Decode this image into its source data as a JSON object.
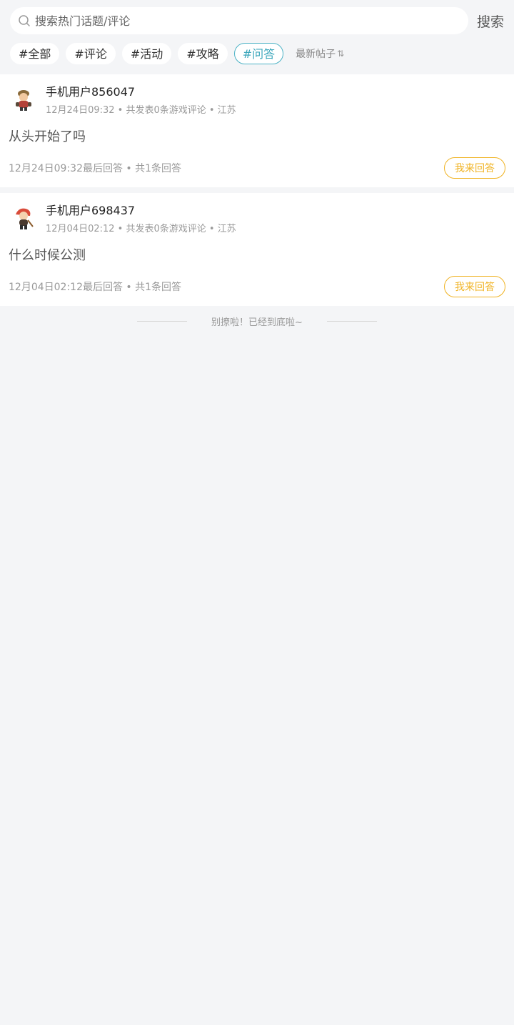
{
  "search": {
    "placeholder": "搜索热门话题/评论",
    "button_label": "搜索",
    "icon": "search-icon"
  },
  "tags": [
    {
      "label": "#全部",
      "active": false
    },
    {
      "label": "#评论",
      "active": false
    },
    {
      "label": "#活动",
      "active": false
    },
    {
      "label": "#攻略",
      "active": false
    },
    {
      "label": "#问答",
      "active": true
    }
  ],
  "sort": {
    "label": "最新帖子",
    "icon": "sort-arrows-icon"
  },
  "posts": [
    {
      "user": "手机用户856047",
      "meta": "12月24日09:32 • 共发表0条游戏评论 • 江苏",
      "content": "从头开始了吗",
      "footer": "12月24日09:32最后回答 • 共1条回答",
      "answer_label": "我来回答"
    },
    {
      "user": "手机用户698437",
      "meta": "12月04日02:12 • 共发表0条游戏评论 • 江苏",
      "content": "什么时候公测",
      "footer": "12月04日02:12最后回答 • 共1条回答",
      "answer_label": "我来回答"
    }
  ],
  "end_text": "别撩啦！已经到底啦~",
  "colors": {
    "accent_teal": "#3aa6bb",
    "answer_yellow": "#f0b323",
    "background": "#f4f5f7"
  }
}
